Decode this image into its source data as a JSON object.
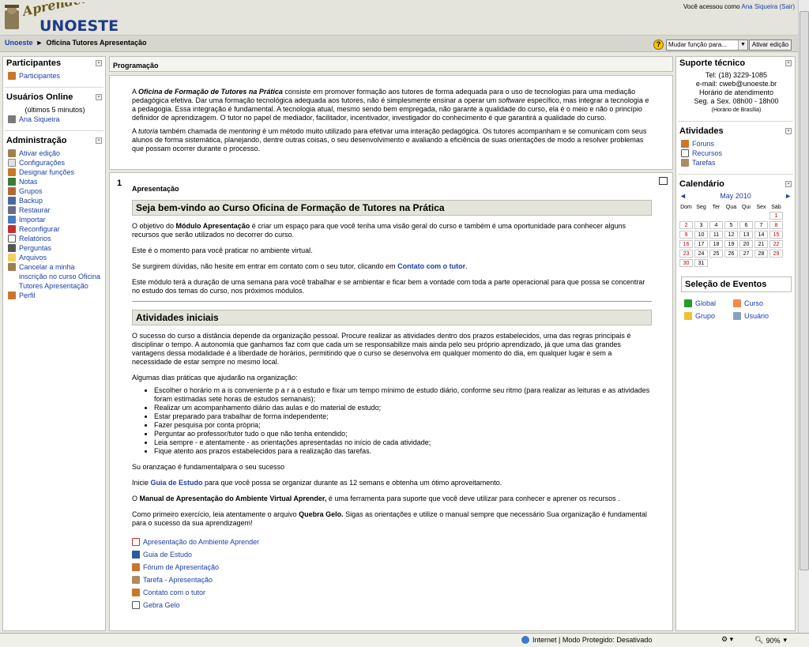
{
  "header": {
    "login_prefix": "Você acessou como",
    "user": "Ana Siqueira",
    "logout": "(Sair)"
  },
  "nav": {
    "home": "Unoeste",
    "arrow": "►",
    "course": "Oficina Tutores Apresentação",
    "role_select": "Mudar função para...",
    "edit_button": "Ativar edição",
    "help": "?"
  },
  "left": {
    "participants": {
      "title": "Participantes",
      "item": "Participantes"
    },
    "online": {
      "title": "Usuários Online",
      "period": "(últimos 5 minutos)",
      "user": "Ana Siqueira"
    },
    "admin": {
      "title": "Administração",
      "items": [
        "Ativar edição",
        "Configurações",
        "Designar funções",
        "Notas",
        "Grupos",
        "Backup",
        "Restaurar",
        "Importar",
        "Reconfigurar",
        "Relatórios",
        "Perguntas",
        "Arquivos",
        "Cancelar a minha inscrição no curso Oficina Tutores Apresentação",
        "Perfil"
      ]
    }
  },
  "main": {
    "program_title": "Programação",
    "intro1": {
      "a": "A ",
      "b": "Oficina de Formação de Tutores na Prática",
      "c": " consiste em promover formação aos tutores de forma adequada para o uso de tecnologias para uma mediação pedagógica efetiva. Dar uma formação tecnológica adequada aos tutores, não é simplesmente ensinar a operar um ",
      "d": "software",
      "e": " específico, mas integrar a tecnologia e a pedagogia. Essa integração é fundamental. A tecnologia atual, mesmo sendo bem empregada, não garante a qualidade do curso, ela é o meio e não o princípio definidor de aprendizagem. O tutor no papel de mediador, facilitador, incentivador, investigador do conhecimento é que garantirá a qualidade do curso."
    },
    "intro2": {
      "a": " A ",
      "b": "tutoria",
      "c": " também chamada de ",
      "d": "mentoring",
      "e": " é um método muito utilizado para efetivar uma interação pedagógica. Os tutores acompanham e se comunicam com seus alunos de forma sistemática, planejando, dentre outras coisas, o seu desenvolvimento e avaliando a eficiência de suas orientações de modo a resolver problemas que possam ocorrer durante o processo."
    },
    "section_number": "1",
    "section_label": "Apresentação",
    "welcome_heading": "Seja bem-vindo ao Curso Oficina de Formação de Tutores na Prática",
    "p1": {
      "a": "O objetivo do ",
      "b": "Módulo Apresentação",
      "c": " é criar um espaço para que você tenha uma visão geral do curso e também é uma oportunidade para conhecer alguns recursos que serão utilizados no decorrer do curso."
    },
    "p2": "Este é o momento para você praticar no ambiente virtual.",
    "p3": {
      "a": "Se surgirem dúvidas, não hesite em entrar em contato com o seu tutor, clicando em ",
      "b": "Contato com o tutor",
      "c": "."
    },
    "p4": "Este módulo terá a duração de uma semana para você trabalhar e se ambientar e ficar bem a vontade com toda a parte operacional para que possa se concentrar no estudo dos temas do curso, nos próximos módulos.",
    "activities_heading": "Atividades iniciais",
    "p5": "O sucesso do curso a distância depende da organização pessoal. Procure realizar as atividades dentro dos prazos estabelecidos, uma das regras principais é disciplinar o tempo. A autonomia que ganhamos faz com que cada um se responsabilize mais ainda pelo seu próprio aprendizado, já que uma das grandes vantagens dessa modalidade é a liberdade de horários, permitindo que o curso se desenvolva em qualquer momento do dia, em qualquer lugar e sem a necessidade de estar sempre no mesmo local.",
    "p6": "Algumas dias práticas que ajudarão na organização:",
    "bullets": [
      "Escolher o horário m a is conveniente p a r a o estudo e fixar um tempo mínimo de estudo diário, conforme seu ritmo (para realizar as leituras e as atividades foram estimadas sete horas de estudos semanais);",
      "Realizar um acompanhamento diário das aulas e do material de estudo;",
      "Estar preparado para trabalhar de forma independente;",
      "Fazer pesquisa por conta própria;",
      "Perguntar ao professor/tutor tudo o que não tenha entendido;",
      "Leia sempre - e atentamente - as orientações apresentadas no início de cada atividade;",
      "Fique atento aos prazos estabelecidos para a realização das tarefas."
    ],
    "p7": "Su oranzaçao é fundamentalpara o seu sucesso",
    "p8": {
      "a": "Inicie ",
      "b": "Guia de Estudo",
      "c": " para que você possa se organizar durante as 12 semans e obtenha um ótimo aproveitamento."
    },
    "p9": {
      "a": "O ",
      "b": "Manual de Apresentação do Ambiente Virtual Aprender,",
      "c": " é uma ferramenta para suporte que você deve utilizar para conhecer e aprener os recursos ."
    },
    "p10": {
      "a": "Como primeiro exercício, leia atentamente o arquivo ",
      "b": "Quebra Gelo.",
      "c": " Sigas as orientações e utilize o manual sempre que necessário Sua organização é fundamental para o sucesso da sua aprendizagem!"
    },
    "resources": [
      "Apresentação do Ambiente Aprender",
      "Guia de Estudo",
      "Fórum de Apresentação",
      "Tarefa - Apresentação",
      "Contato com o tutor",
      "Gebra Gelo"
    ]
  },
  "right": {
    "support": {
      "title": "Suporte técnico",
      "lines": [
        "Tel: (18) 3229-1085",
        "e-mail: cweb@unoeste.br",
        "Horário de atendimento",
        "Seg. a Sex. 08h00 - 18h00"
      ],
      "timezone": "(Horário de Brasília)"
    },
    "activities": {
      "title": "Atividades",
      "items": [
        "Fóruns",
        "Recursos",
        "Tarefas"
      ]
    },
    "calendar": {
      "title": "Calendário",
      "prev": "◄",
      "next": "►",
      "month": "May 2010",
      "days": [
        "Dom",
        "Seg",
        "Ter",
        "Qua",
        "Qui",
        "Sex",
        "Sáb"
      ],
      "weeks": [
        [
          "",
          "",
          "",
          "",
          "",
          "",
          "1"
        ],
        [
          "2",
          "3",
          "4",
          "5",
          "6",
          "7",
          "8"
        ],
        [
          "9",
          "10",
          "11",
          "12",
          "13",
          "14",
          "15"
        ],
        [
          "16",
          "17",
          "18",
          "19",
          "20",
          "21",
          "22"
        ],
        [
          "23",
          "24",
          "25",
          "26",
          "27",
          "28",
          "29"
        ],
        [
          "30",
          "31",
          "",
          "",
          "",
          "",
          ""
        ]
      ]
    },
    "events": {
      "title": "Seleção de Eventos",
      "items": [
        "Global",
        "Curso",
        "Grupo",
        "Usuário"
      ]
    }
  },
  "status": {
    "zone": "Internet | Modo Protegido: Desativado",
    "zoom": "90%"
  }
}
